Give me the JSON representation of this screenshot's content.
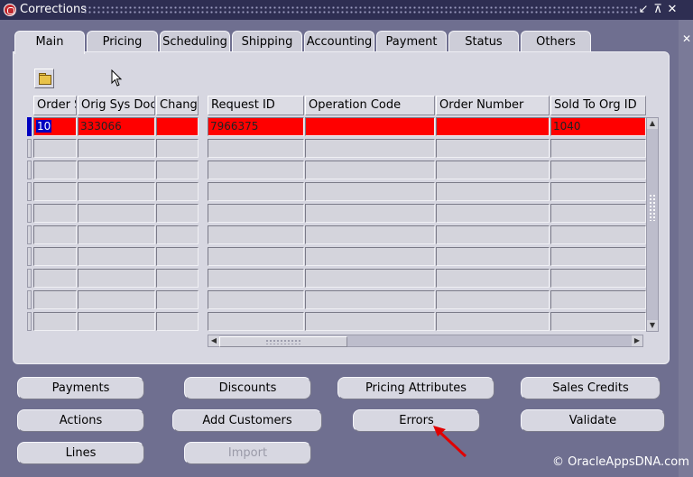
{
  "window": {
    "title": "Corrections",
    "controls": [
      "↙",
      "⊼",
      "✕"
    ],
    "side_close": "✕"
  },
  "tabs": [
    {
      "label": "Main",
      "active": true
    },
    {
      "label": "Pricing"
    },
    {
      "label": "Scheduling"
    },
    {
      "label": "Shipping"
    },
    {
      "label": "Accounting"
    },
    {
      "label": "Payment"
    },
    {
      "label": "Status"
    },
    {
      "label": "Others"
    }
  ],
  "toolbar": {
    "icon": "open-folder-icon"
  },
  "table_left": {
    "columns": [
      "Order Source",
      "Orig Sys Document Ref",
      "Change Sequence"
    ],
    "rows": [
      [
        "10",
        "333066",
        ""
      ]
    ]
  },
  "table_right": {
    "columns": [
      "Request ID",
      "Operation Code",
      "Order Number",
      "Sold To Org ID"
    ],
    "rows": [
      [
        "7966375",
        "",
        "",
        "1040"
      ]
    ]
  },
  "highlight_color": "#ff0000",
  "buttons": {
    "payments": "Payments",
    "discounts": "Discounts",
    "pricing_attributes": "Pricing Attributes",
    "sales_credits": "Sales Credits",
    "actions": "Actions",
    "add_customers": "Add Customers",
    "errors": "Errors",
    "validate": "Validate",
    "lines": "Lines",
    "import": "Import"
  },
  "footer": "© OracleAppsDNA.com"
}
